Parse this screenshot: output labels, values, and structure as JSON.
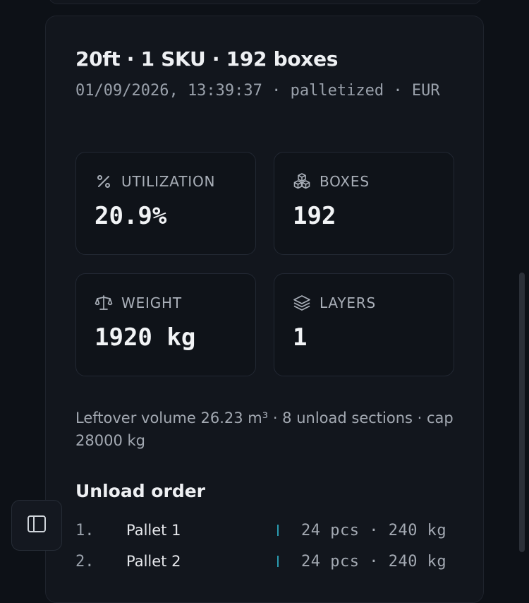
{
  "summary": {
    "title": "20ft · 1 SKU · 192 boxes",
    "subtitle": "01/09/2026, 13:39:37 · palletized · EUR"
  },
  "stats": [
    {
      "label": "UTILIZATION",
      "value": "20.9%",
      "icon": "percent-icon"
    },
    {
      "label": "BOXES",
      "value": "192",
      "icon": "boxes-icon"
    },
    {
      "label": "WEIGHT",
      "value": "1920 kg",
      "icon": "scale-icon"
    },
    {
      "label": "LAYERS",
      "value": "1",
      "icon": "layers-icon"
    }
  ],
  "note": "Leftover volume 26.23 m³ · 8 unload sections · cap 28000 kg",
  "unload": {
    "title": "Unload order",
    "rows": [
      {
        "index": "1.",
        "name": "Pallet 1",
        "meta": "24 pcs · 240 kg"
      },
      {
        "index": "2.",
        "name": "Pallet 2",
        "meta": "24 pcs · 240 kg"
      }
    ]
  },
  "colors": {
    "background": "#0d1117",
    "card": "#12161d",
    "accent": "#2a9bb0"
  }
}
